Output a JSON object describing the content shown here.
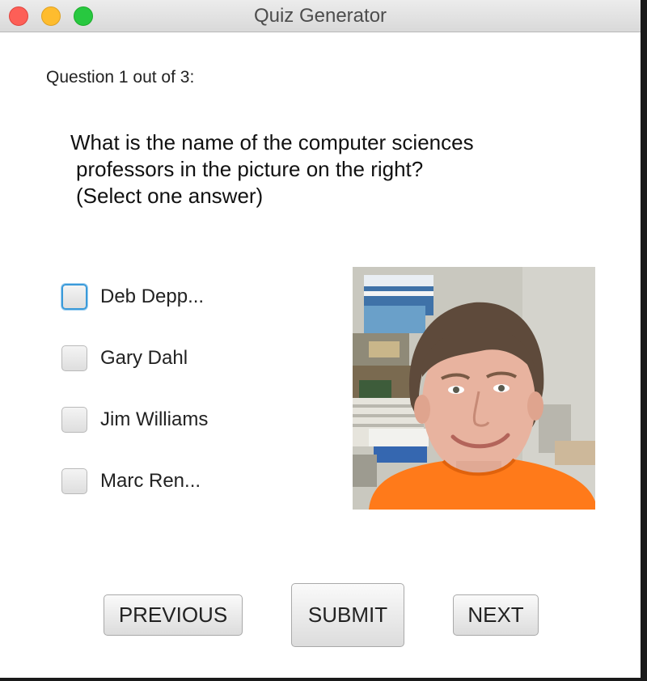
{
  "window": {
    "title": "Quiz Generator"
  },
  "question": {
    "counter": "Question 1 out of 3:",
    "lines": [
      "What is the name of the computer sciences",
      "professors in the picture on the right?",
      "(Select one answer)"
    ]
  },
  "options": [
    {
      "label": "Deb Depp...",
      "checked": false,
      "focused": true
    },
    {
      "label": "Gary Dahl",
      "checked": false,
      "focused": false
    },
    {
      "label": "Jim Williams",
      "checked": false,
      "focused": false
    },
    {
      "label": "Marc Ren...",
      "checked": false,
      "focused": false
    }
  ],
  "buttons": {
    "previous": "PREVIOUS",
    "submit": "SUBMIT",
    "next": "NEXT"
  },
  "colors": {
    "focus_ring": "#3a9ad9",
    "shirt": "#ff7a1a",
    "close": "#fd5f57",
    "minimize": "#febc2e",
    "maximize": "#28c840"
  }
}
